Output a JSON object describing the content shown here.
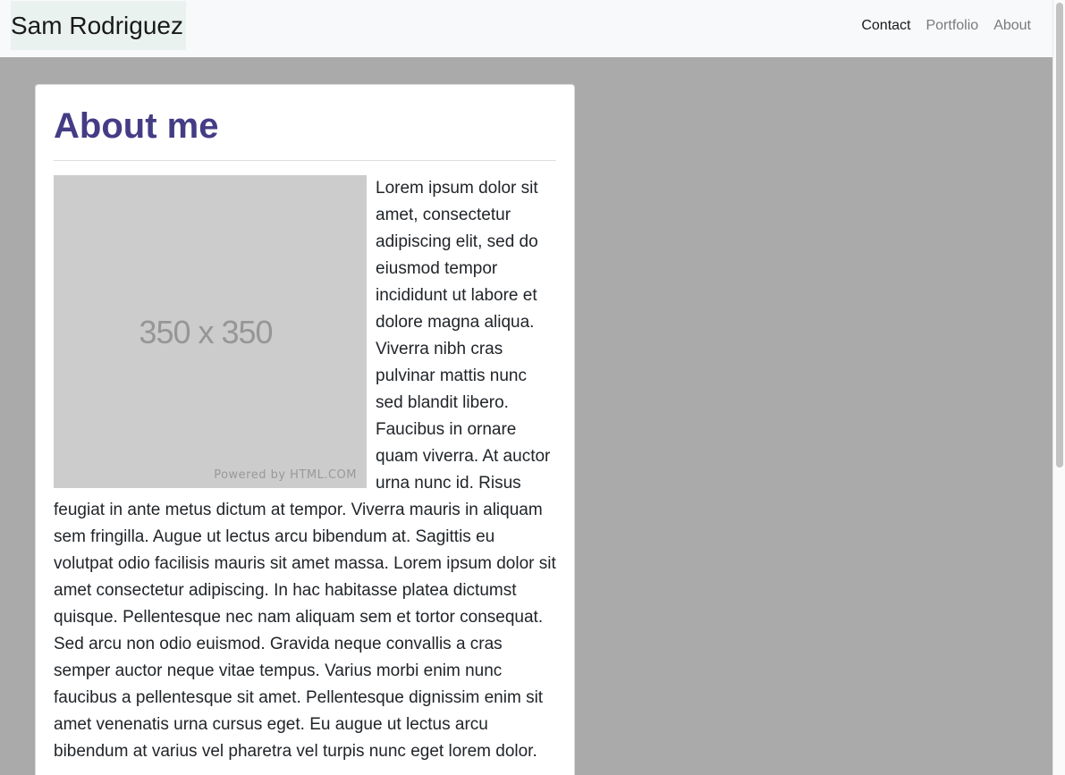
{
  "navbar": {
    "brand": "Sam Rodriguez",
    "links": [
      {
        "label": "Contact",
        "active": true
      },
      {
        "label": "Portfolio",
        "active": false
      },
      {
        "label": "About",
        "active": false
      }
    ]
  },
  "about": {
    "title": "About me",
    "image": {
      "size_label": "350 x 350",
      "credit": "Powered by HTML.COM"
    },
    "body": "Lorem ipsum dolor sit amet, consectetur adipiscing elit, sed do eiusmod tempor incididunt ut labore et dolore magna aliqua. Viverra nibh cras pulvinar mattis nunc sed blandit libero. Faucibus in ornare quam viverra. At auctor urna nunc id. Risus feugiat in ante metus dictum at tempor. Viverra mauris in aliquam sem fringilla. Augue ut lectus arcu bibendum at. Sagittis eu volutpat odio facilisis mauris sit amet massa. Lorem ipsum dolor sit amet consectetur adipiscing. In hac habitasse platea dictumst quisque. Pellentesque nec nam aliquam sem et tortor consequat. Sed arcu non odio euismod. Gravida neque convallis a cras semper auctor neque vitae tempus. Varius morbi enim nunc faucibus a pellentesque sit amet. Pellentesque dignissim enim sit amet venenatis urna cursus eget. Eu augue ut lectus arcu bibendum at varius vel pharetra vel turpis nunc eget lorem dolor."
  },
  "colors": {
    "page_background": "#aaaaaa",
    "navbar_background": "#f8f9fa",
    "brand_highlight": "#e9f2ef",
    "title": "#443c85",
    "placeholder": "#cccccc"
  }
}
